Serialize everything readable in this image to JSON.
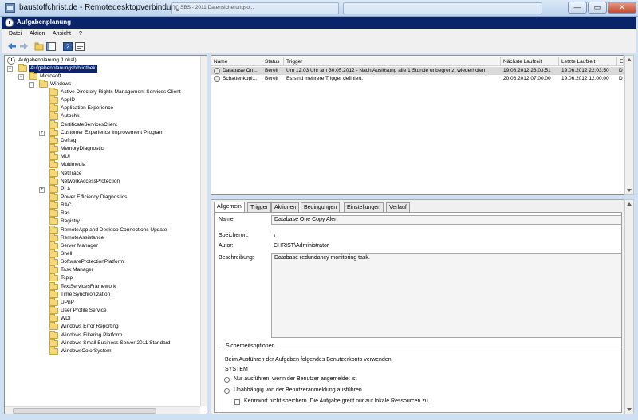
{
  "rdp": {
    "title": "baustoffchrist.de - Remotedesktopverbindung",
    "thumbnail_label": "SBS - 2011 Datensicherungso...",
    "minimize": "—",
    "restore": "▭",
    "close": "✕"
  },
  "window": {
    "title": "Aufgabenplanung"
  },
  "menu": {
    "items": [
      "Datei",
      "Aktion",
      "Ansicht",
      "?"
    ]
  },
  "toolbar": {
    "icons": [
      "back-arrow-icon",
      "forward-arrow-icon",
      "up-folder-icon",
      "show-hide-console-tree-icon",
      "help-icon",
      "properties-icon"
    ]
  },
  "tree": {
    "root": "Aufgabenplanung (Lokal)",
    "library": "Aufgabenplanungsbibliothek",
    "microsoft": "Microsoft",
    "windows": "Windows",
    "expander_collapsed": "+",
    "expander_expanded": "−",
    "children": [
      {
        "label": "Active Directory Rights Management Services Client"
      },
      {
        "label": "AppID"
      },
      {
        "label": "Application Experience"
      },
      {
        "label": "Autochk"
      },
      {
        "label": "CertificateServicesClient"
      },
      {
        "label": "Customer Experience Improvement Program",
        "expandable": true
      },
      {
        "label": "Defrag"
      },
      {
        "label": "MemoryDiagnostic"
      },
      {
        "label": "MUI"
      },
      {
        "label": "Multimedia"
      },
      {
        "label": "NetTrace"
      },
      {
        "label": "NetworkAccessProtection"
      },
      {
        "label": "PLA",
        "expandable": true
      },
      {
        "label": "Power Efficiency Diagnostics"
      },
      {
        "label": "RAC"
      },
      {
        "label": "Ras"
      },
      {
        "label": "Registry"
      },
      {
        "label": "RemoteApp and Desktop Connections Update"
      },
      {
        "label": "RemoteAssistance"
      },
      {
        "label": "Server Manager"
      },
      {
        "label": "Shell"
      },
      {
        "label": "SoftwareProtectionPlatform"
      },
      {
        "label": "Task Manager"
      },
      {
        "label": "Tcpip"
      },
      {
        "label": "TextServicesFramework"
      },
      {
        "label": "Time Synchronization"
      },
      {
        "label": "UPnP"
      },
      {
        "label": "User Profile Service"
      },
      {
        "label": "WDI"
      },
      {
        "label": "Windows Error Reporting"
      },
      {
        "label": "Windows Filtering Platform"
      },
      {
        "label": "Windows Small Business Server 2011 Standard"
      },
      {
        "label": "WindowsColorSystem"
      }
    ]
  },
  "tasks": {
    "columns": [
      "Name",
      "Status",
      "Trigger",
      "Nächste Laufzeit",
      "Letzte Laufzeit",
      "E"
    ],
    "rows": [
      {
        "name": "Database On...",
        "status": "Bereit",
        "trigger": "Um 12:03 Uhr am 30.05.2012 - Nach Auslösung alle 1 Stunde unbegrenzt wiederholen.",
        "next": "19.06.2012 23:03:51",
        "last": "19.06.2012 22:03:50",
        "e": "D",
        "selected": true
      },
      {
        "name": "Schattenkopi...",
        "status": "Bereit",
        "trigger": "Es sind mehrere Trigger definiert.",
        "next": "20.06.2012 07:00:00",
        "last": "19.06.2012 12:00:00",
        "e": "D",
        "selected": false
      }
    ]
  },
  "details": {
    "tabs": [
      "Allgemein",
      "Trigger",
      "Aktionen",
      "Bedingungen",
      "Einstellungen",
      "Verlauf"
    ],
    "name_label": "Name:",
    "name_value": "Database One Copy Alert",
    "location_label": "Speicherort:",
    "location_value": "\\",
    "author_label": "Autor:",
    "author_value": "CHRIST\\Administrator",
    "description_label": "Beschreibung:",
    "description_value": "Database redundancy monitoring task.",
    "security": {
      "title": "Sicherheitsoptionen",
      "account_text": "Beim Ausführen der Aufgaben folgendes Benutzerkonto verwenden:",
      "account": "SYSTEM",
      "radio1": "Nur ausführen, wenn der Benutzer angemeldet ist",
      "radio2": "Unabhängig von der Benutzeranmeldung ausführen",
      "checkbox": "Kennwort nicht speichern. Die Aufgabe greift nur auf lokale Ressourcen zu."
    }
  }
}
